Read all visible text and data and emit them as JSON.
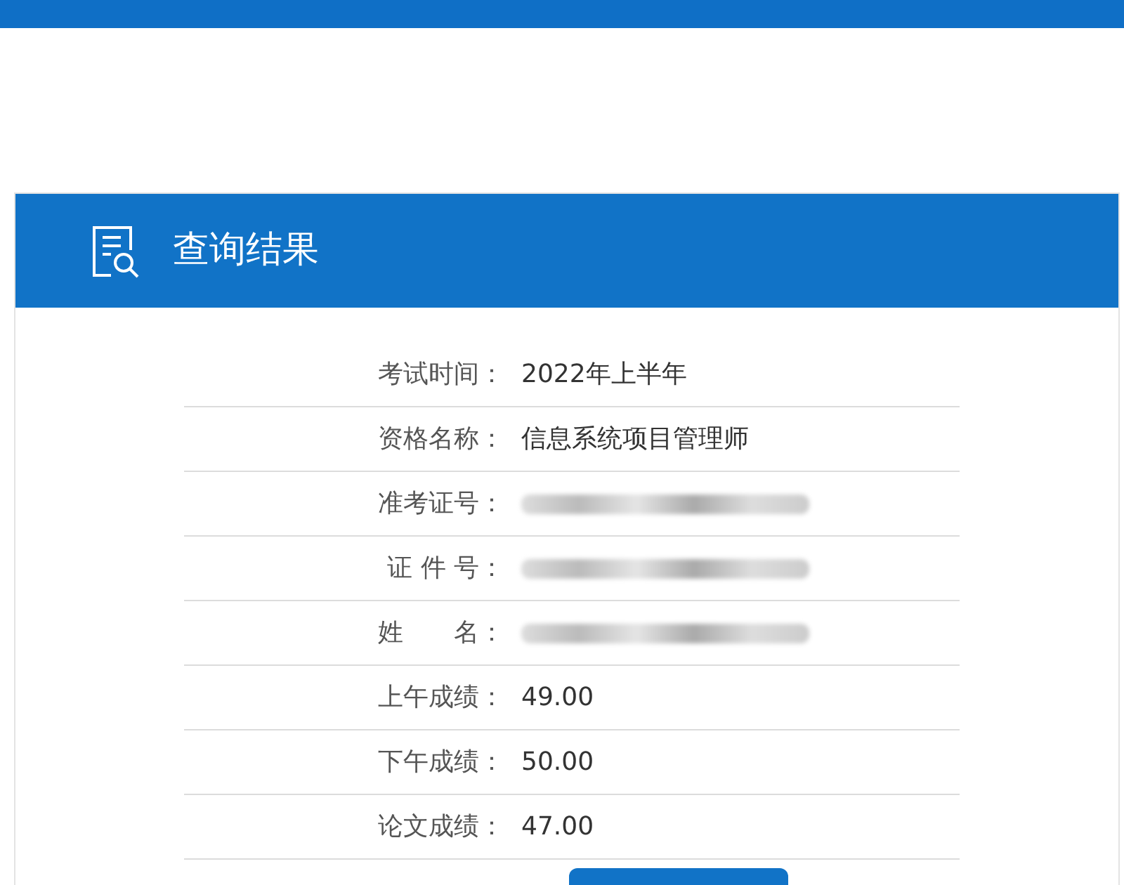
{
  "panel": {
    "title": "查询结果"
  },
  "rows": [
    {
      "label": "考试时间：",
      "kind": "text",
      "value": "2022年上半年"
    },
    {
      "label": "资格名称：",
      "kind": "text",
      "value": "信息系统项目管理师"
    },
    {
      "label": "准考证号：",
      "kind": "redacted"
    },
    {
      "label": "证 件 号：",
      "kind": "redacted"
    },
    {
      "label": "姓　　名：",
      "kind": "redacted"
    },
    {
      "label": "上午成绩：",
      "kind": "text",
      "value": "49.00"
    },
    {
      "label": "下午成绩：",
      "kind": "text",
      "value": "50.00"
    },
    {
      "label": "论文成绩：",
      "kind": "text",
      "value": "47.00"
    }
  ]
}
